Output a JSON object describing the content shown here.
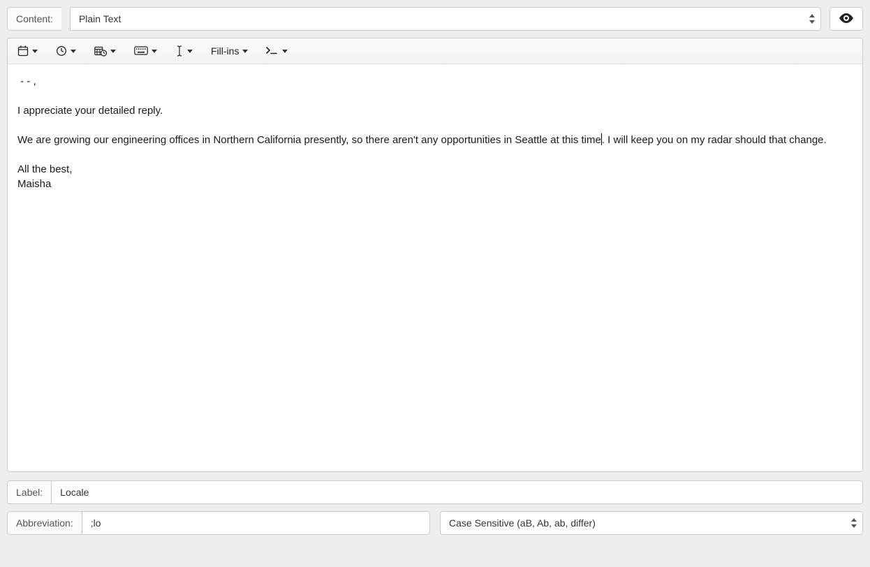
{
  "content_row": {
    "label": "Content:",
    "selected": "Plain Text"
  },
  "toolbar": {
    "fillins_label": "Fill-ins"
  },
  "editor": {
    "line1": " - - ,",
    "line2": "",
    "line3": "I appreciate your detailed reply.",
    "line4": "",
    "para_before_caret": "We are growing our engineering offices in Northern California presently, so there aren't any opportunities in Seattle at this time",
    "para_after_caret": ". I will keep you on my radar should that change.",
    "line6": "",
    "line7": "All the best,",
    "line8": "Maisha"
  },
  "fields": {
    "label_label": "Label:",
    "label_value": "Locale",
    "abbr_label": "Abbreviation:",
    "abbr_value": ";lo",
    "case_selected": "Case Sensitive (aB, Ab, ab, differ)"
  }
}
